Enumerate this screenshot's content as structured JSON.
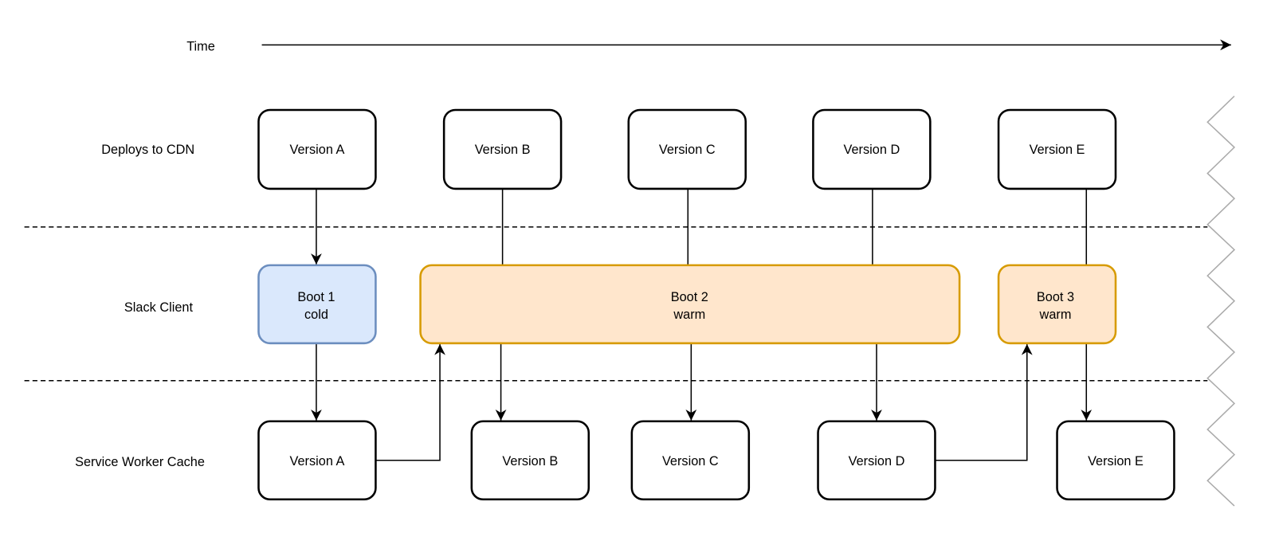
{
  "time_label": "Time",
  "lanes": {
    "cdn": "Deploys to CDN",
    "client": "Slack Client",
    "cache": "Service Worker Cache"
  },
  "cdn_versions": [
    "Version A",
    "Version B",
    "Version C",
    "Version D",
    "Version E"
  ],
  "boots": [
    {
      "title": "Boot 1",
      "type": "cold"
    },
    {
      "title": "Boot 2",
      "type": "warm"
    },
    {
      "title": "Boot 3",
      "type": "warm"
    }
  ],
  "cache_versions": [
    "Version A",
    "Version B",
    "Version C",
    "Version D",
    "Version E"
  ],
  "colors": {
    "cold_fill": "#dae8fc",
    "cold_stroke": "#6c8ebf",
    "warm_fill": "#ffe6cc",
    "warm_stroke": "#d79b00"
  }
}
